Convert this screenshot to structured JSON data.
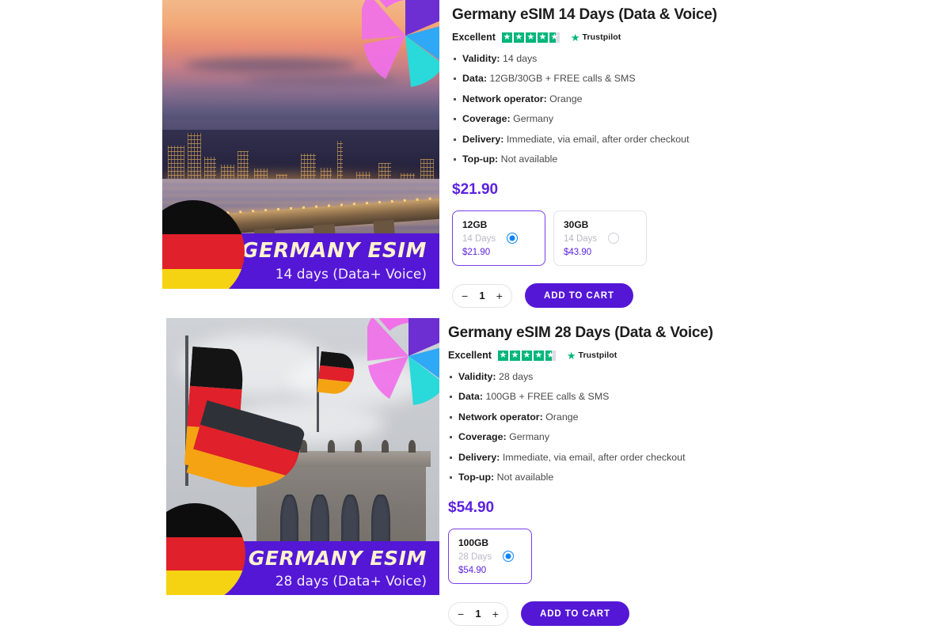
{
  "products": [
    {
      "title": "Germany eSIM 14 Days (Data & Voice)",
      "rating": {
        "word": "Excellent",
        "stars_filled": 4.6,
        "brand": "Trustpilot",
        "star_icon": "star-icon"
      },
      "specs": [
        {
          "label": "Validity:",
          "value": "14 days"
        },
        {
          "label": "Data:",
          "value": "12GB/30GB + FREE calls & SMS"
        },
        {
          "label": "Network operator:",
          "value": "Orange"
        },
        {
          "label": "Coverage:",
          "value": "Germany"
        },
        {
          "label": "Delivery:",
          "value": "Immediate, via email, after order checkout"
        },
        {
          "label": "Top-up:",
          "value": "Not available"
        }
      ],
      "price": "$21.90",
      "variants": [
        {
          "size": "12GB",
          "days": "14 Days",
          "price": "$21.90",
          "selected": true
        },
        {
          "size": "30GB",
          "days": "14 Days",
          "price": "$43.90",
          "selected": false
        }
      ],
      "quantity": "1",
      "decrement_label": "−",
      "increment_label": "+",
      "cart_label": "ADD TO CART",
      "image": {
        "banner_title": "GERMANY ESIM",
        "banner_sub": "14 days (Data+ Voice)"
      }
    },
    {
      "title": "Germany eSIM 28 Days (Data & Voice)",
      "rating": {
        "word": "Excellent",
        "stars_filled": 4.6,
        "brand": "Trustpilot",
        "star_icon": "star-icon"
      },
      "specs": [
        {
          "label": "Validity:",
          "value": "28 days"
        },
        {
          "label": "Data:",
          "value": "100GB + FREE calls & SMS"
        },
        {
          "label": "Network operator:",
          "value": "Orange"
        },
        {
          "label": "Coverage:",
          "value": "Germany"
        },
        {
          "label": "Delivery:",
          "value": "Immediate, via email, after order checkout"
        },
        {
          "label": "Top-up:",
          "value": "Not available"
        }
      ],
      "price": "$54.90",
      "variants": [
        {
          "size": "100GB",
          "days": "28 Days",
          "price": "$54.90",
          "selected": true
        }
      ],
      "quantity": "1",
      "decrement_label": "−",
      "increment_label": "+",
      "cart_label": "ADD TO CART",
      "image": {
        "banner_title": "GERMANY ESIM",
        "banner_sub": "28 days (Data+ Voice)"
      }
    }
  ],
  "colors": {
    "brand_purple": "#5417d6",
    "price_purple": "#5b21e0",
    "radio_blue": "#0a84ff",
    "trustpilot_green": "#00b67a",
    "flag_black": "#0d0d0d",
    "flag_red": "#e0202a",
    "flag_gold": "#f5d312"
  }
}
